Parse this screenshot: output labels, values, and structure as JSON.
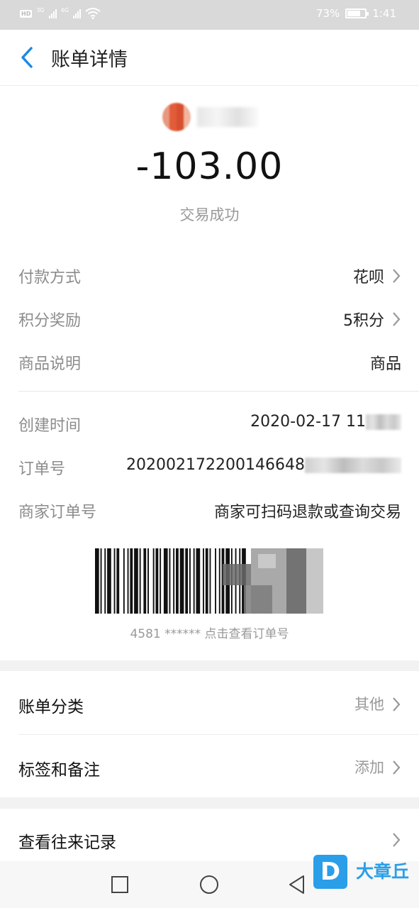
{
  "status_bar": {
    "left_badge": "HD",
    "network_1": "3G",
    "network_2": "4G",
    "battery_percent": "73%",
    "battery_level": 0.73,
    "time": "1:41"
  },
  "header": {
    "title": "账单详情",
    "back_icon": "chevron-left-icon"
  },
  "transaction": {
    "amount": "-103.00",
    "status": "交易成功"
  },
  "details": [
    {
      "label": "付款方式",
      "value": "花呗"
    },
    {
      "label": "积分奖励",
      "value": "5积分"
    },
    {
      "label": "商品说明",
      "value": "商品"
    },
    {
      "label": "创建时间",
      "value": "2020-02-17 11"
    },
    {
      "label": "订单号",
      "value": "20200217220014664​8"
    },
    {
      "label": "商家订单号",
      "value": "商家可扫码退款或查询交易"
    }
  ],
  "barcode": {
    "caption": "4581 ****** 点击查看订单号"
  },
  "sections": [
    {
      "label": "账单分类",
      "value": "其他"
    },
    {
      "label": "标签和备注",
      "value": "添加"
    },
    {
      "label": "查看往来记录",
      "value": ""
    }
  ],
  "watermark": {
    "logo_letter": "D",
    "text": "大章丘"
  },
  "colors": {
    "accent": "#2a9ee8",
    "back_arrow": "#1e88e5",
    "label_gray": "#8c8c8c",
    "value_gray": "#999999"
  }
}
